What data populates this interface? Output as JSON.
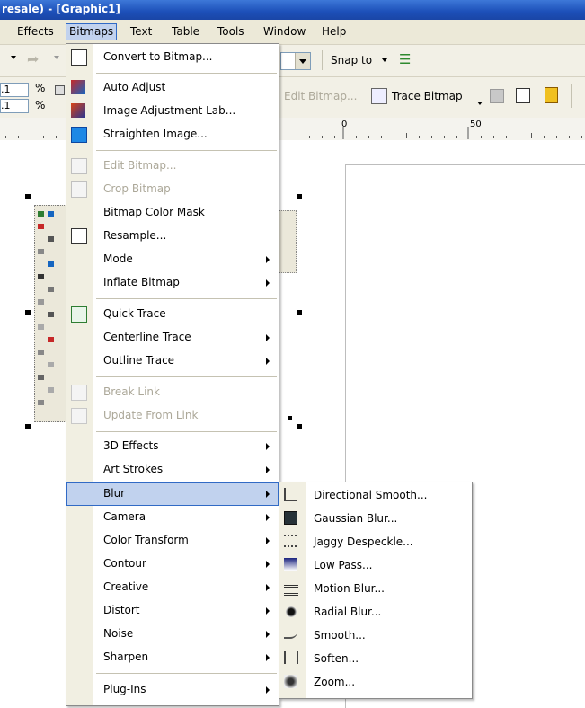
{
  "window": {
    "title": "resale) - [Graphic1]"
  },
  "menubar": {
    "items": [
      {
        "label": "Effects"
      },
      {
        "label": "Bitmaps"
      },
      {
        "label": "Text"
      },
      {
        "label": "Table"
      },
      {
        "label": "Tools"
      },
      {
        "label": "Window"
      },
      {
        "label": "Help"
      }
    ]
  },
  "toolbar": {
    "snap_to": "Snap to",
    "edit_bitmap": "Edit Bitmap...",
    "trace_bitmap": "Trace Bitmap",
    "field1": ".1",
    "field2": ".1",
    "percent1": "%",
    "percent2": "%"
  },
  "ruler": {
    "tick0": "0",
    "tick50": "50"
  },
  "bitmaps_menu": {
    "items": [
      {
        "label": "Convert to Bitmap...",
        "icon": "convert-bitmap-icon"
      },
      {
        "label": "Auto Adjust",
        "icon": "auto-adjust-icon"
      },
      {
        "label": "Image Adjustment Lab...",
        "icon": "image-adjustment-lab-icon"
      },
      {
        "label": "Straighten Image...",
        "icon": "straighten-image-icon"
      },
      {
        "label": "Edit Bitmap...",
        "icon": "edit-bitmap-icon",
        "disabled": true
      },
      {
        "label": "Crop Bitmap",
        "icon": "crop-bitmap-icon",
        "disabled": true
      },
      {
        "label": "Bitmap Color Mask"
      },
      {
        "label": "Resample...",
        "icon": "resample-icon"
      },
      {
        "label": "Mode",
        "submenu": true
      },
      {
        "label": "Inflate Bitmap",
        "submenu": true
      },
      {
        "label": "Quick Trace",
        "icon": "quick-trace-icon"
      },
      {
        "label": "Centerline Trace",
        "submenu": true
      },
      {
        "label": "Outline Trace",
        "submenu": true
      },
      {
        "label": "Break Link",
        "icon": "break-link-icon",
        "disabled": true
      },
      {
        "label": "Update From Link",
        "icon": "update-link-icon",
        "disabled": true
      },
      {
        "label": "3D Effects",
        "submenu": true
      },
      {
        "label": "Art Strokes",
        "submenu": true
      },
      {
        "label": "Blur",
        "submenu": true,
        "highlighted": true
      },
      {
        "label": "Camera",
        "submenu": true
      },
      {
        "label": "Color Transform",
        "submenu": true
      },
      {
        "label": "Contour",
        "submenu": true
      },
      {
        "label": "Creative",
        "submenu": true
      },
      {
        "label": "Distort",
        "submenu": true
      },
      {
        "label": "Noise",
        "submenu": true
      },
      {
        "label": "Sharpen",
        "submenu": true
      },
      {
        "label": "Plug-Ins",
        "submenu": true
      }
    ]
  },
  "blur_submenu": {
    "items": [
      {
        "label": "Directional Smooth...",
        "icon": "directional-smooth-icon"
      },
      {
        "label": "Gaussian Blur...",
        "icon": "gaussian-blur-icon"
      },
      {
        "label": "Jaggy Despeckle...",
        "icon": "jaggy-despeckle-icon"
      },
      {
        "label": "Low Pass...",
        "icon": "low-pass-icon"
      },
      {
        "label": "Motion Blur...",
        "icon": "motion-blur-icon"
      },
      {
        "label": "Radial Blur...",
        "icon": "radial-blur-icon"
      },
      {
        "label": "Smooth...",
        "icon": "smooth-icon"
      },
      {
        "label": "Soften...",
        "icon": "soften-icon"
      },
      {
        "label": "Zoom...",
        "icon": "zoom-blur-icon"
      }
    ]
  },
  "colors": {
    "highlight": "#c1d2ee",
    "highlight_border": "#316ac5",
    "titlebar": "#1c4fb8",
    "menubar": "#ece9d8"
  }
}
